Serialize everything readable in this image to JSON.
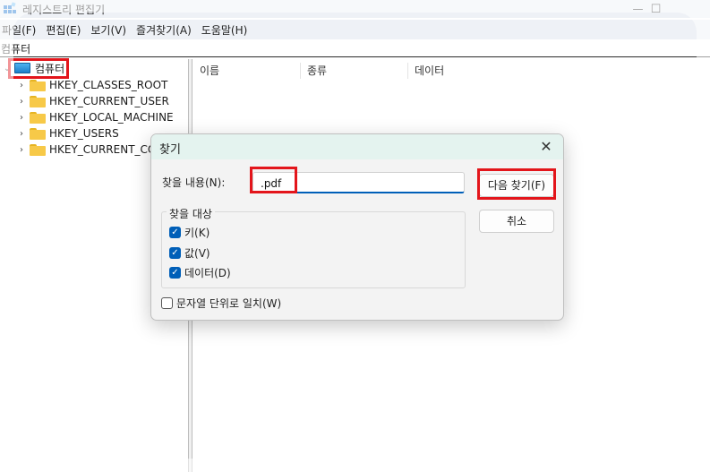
{
  "window": {
    "title": "레지스트리 편집기",
    "controls": {
      "minimize": "—",
      "maximize": "☐"
    }
  },
  "menu": [
    "파일(F)",
    "편집(E)",
    "보기(V)",
    "즐겨찾기(A)",
    "도움말(H)"
  ],
  "address": "컴퓨터",
  "tree": {
    "root": "컴퓨터",
    "children": [
      "HKEY_CLASSES_ROOT",
      "HKEY_CURRENT_USER",
      "HKEY_LOCAL_MACHINE",
      "HKEY_USERS",
      "HKEY_CURRENT_CON"
    ]
  },
  "list": {
    "columns": [
      "이름",
      "종류",
      "데이터"
    ]
  },
  "dialog": {
    "title": "찾기",
    "find_label": "찾을 내용(N):",
    "find_value": ".pdf",
    "group_title": "찾을 대상",
    "options": [
      {
        "label": "키(K)",
        "checked": true
      },
      {
        "label": "값(V)",
        "checked": true
      },
      {
        "label": "데이터(D)",
        "checked": true
      }
    ],
    "whole_string": {
      "label": "문자열 단위로 일치(W)",
      "checked": false
    },
    "find_next_button": "다음 찾기(F)",
    "cancel_button": "취소",
    "close_glyph": "✕"
  },
  "colors": {
    "highlight": "#e3151b",
    "accent": "#005fb8",
    "dialog_title_bg": "#e4f3ef"
  }
}
